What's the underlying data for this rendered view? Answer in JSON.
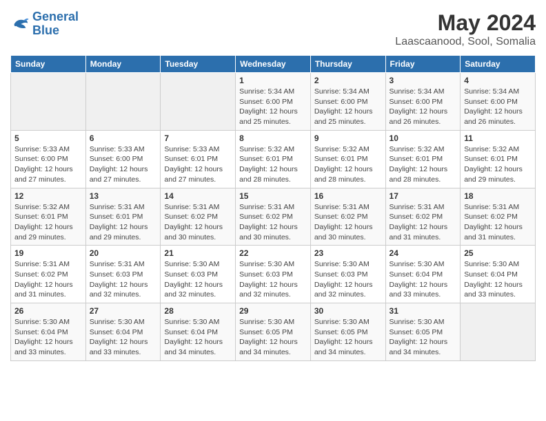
{
  "logo": {
    "line1": "General",
    "line2": "Blue"
  },
  "title": "May 2024",
  "location": "Laascaanood, Sool, Somalia",
  "days_of_week": [
    "Sunday",
    "Monday",
    "Tuesday",
    "Wednesday",
    "Thursday",
    "Friday",
    "Saturday"
  ],
  "weeks": [
    [
      {
        "day": "",
        "info": ""
      },
      {
        "day": "",
        "info": ""
      },
      {
        "day": "",
        "info": ""
      },
      {
        "day": "1",
        "info": "Sunrise: 5:34 AM\nSunset: 6:00 PM\nDaylight: 12 hours\nand 25 minutes."
      },
      {
        "day": "2",
        "info": "Sunrise: 5:34 AM\nSunset: 6:00 PM\nDaylight: 12 hours\nand 25 minutes."
      },
      {
        "day": "3",
        "info": "Sunrise: 5:34 AM\nSunset: 6:00 PM\nDaylight: 12 hours\nand 26 minutes."
      },
      {
        "day": "4",
        "info": "Sunrise: 5:34 AM\nSunset: 6:00 PM\nDaylight: 12 hours\nand 26 minutes."
      }
    ],
    [
      {
        "day": "5",
        "info": "Sunrise: 5:33 AM\nSunset: 6:00 PM\nDaylight: 12 hours\nand 27 minutes."
      },
      {
        "day": "6",
        "info": "Sunrise: 5:33 AM\nSunset: 6:00 PM\nDaylight: 12 hours\nand 27 minutes."
      },
      {
        "day": "7",
        "info": "Sunrise: 5:33 AM\nSunset: 6:01 PM\nDaylight: 12 hours\nand 27 minutes."
      },
      {
        "day": "8",
        "info": "Sunrise: 5:32 AM\nSunset: 6:01 PM\nDaylight: 12 hours\nand 28 minutes."
      },
      {
        "day": "9",
        "info": "Sunrise: 5:32 AM\nSunset: 6:01 PM\nDaylight: 12 hours\nand 28 minutes."
      },
      {
        "day": "10",
        "info": "Sunrise: 5:32 AM\nSunset: 6:01 PM\nDaylight: 12 hours\nand 28 minutes."
      },
      {
        "day": "11",
        "info": "Sunrise: 5:32 AM\nSunset: 6:01 PM\nDaylight: 12 hours\nand 29 minutes."
      }
    ],
    [
      {
        "day": "12",
        "info": "Sunrise: 5:32 AM\nSunset: 6:01 PM\nDaylight: 12 hours\nand 29 minutes."
      },
      {
        "day": "13",
        "info": "Sunrise: 5:31 AM\nSunset: 6:01 PM\nDaylight: 12 hours\nand 29 minutes."
      },
      {
        "day": "14",
        "info": "Sunrise: 5:31 AM\nSunset: 6:02 PM\nDaylight: 12 hours\nand 30 minutes."
      },
      {
        "day": "15",
        "info": "Sunrise: 5:31 AM\nSunset: 6:02 PM\nDaylight: 12 hours\nand 30 minutes."
      },
      {
        "day": "16",
        "info": "Sunrise: 5:31 AM\nSunset: 6:02 PM\nDaylight: 12 hours\nand 30 minutes."
      },
      {
        "day": "17",
        "info": "Sunrise: 5:31 AM\nSunset: 6:02 PM\nDaylight: 12 hours\nand 31 minutes."
      },
      {
        "day": "18",
        "info": "Sunrise: 5:31 AM\nSunset: 6:02 PM\nDaylight: 12 hours\nand 31 minutes."
      }
    ],
    [
      {
        "day": "19",
        "info": "Sunrise: 5:31 AM\nSunset: 6:02 PM\nDaylight: 12 hours\nand 31 minutes."
      },
      {
        "day": "20",
        "info": "Sunrise: 5:31 AM\nSunset: 6:03 PM\nDaylight: 12 hours\nand 32 minutes."
      },
      {
        "day": "21",
        "info": "Sunrise: 5:30 AM\nSunset: 6:03 PM\nDaylight: 12 hours\nand 32 minutes."
      },
      {
        "day": "22",
        "info": "Sunrise: 5:30 AM\nSunset: 6:03 PM\nDaylight: 12 hours\nand 32 minutes."
      },
      {
        "day": "23",
        "info": "Sunrise: 5:30 AM\nSunset: 6:03 PM\nDaylight: 12 hours\nand 32 minutes."
      },
      {
        "day": "24",
        "info": "Sunrise: 5:30 AM\nSunset: 6:04 PM\nDaylight: 12 hours\nand 33 minutes."
      },
      {
        "day": "25",
        "info": "Sunrise: 5:30 AM\nSunset: 6:04 PM\nDaylight: 12 hours\nand 33 minutes."
      }
    ],
    [
      {
        "day": "26",
        "info": "Sunrise: 5:30 AM\nSunset: 6:04 PM\nDaylight: 12 hours\nand 33 minutes."
      },
      {
        "day": "27",
        "info": "Sunrise: 5:30 AM\nSunset: 6:04 PM\nDaylight: 12 hours\nand 33 minutes."
      },
      {
        "day": "28",
        "info": "Sunrise: 5:30 AM\nSunset: 6:04 PM\nDaylight: 12 hours\nand 34 minutes."
      },
      {
        "day": "29",
        "info": "Sunrise: 5:30 AM\nSunset: 6:05 PM\nDaylight: 12 hours\nand 34 minutes."
      },
      {
        "day": "30",
        "info": "Sunrise: 5:30 AM\nSunset: 6:05 PM\nDaylight: 12 hours\nand 34 minutes."
      },
      {
        "day": "31",
        "info": "Sunrise: 5:30 AM\nSunset: 6:05 PM\nDaylight: 12 hours\nand 34 minutes."
      },
      {
        "day": "",
        "info": ""
      }
    ]
  ]
}
